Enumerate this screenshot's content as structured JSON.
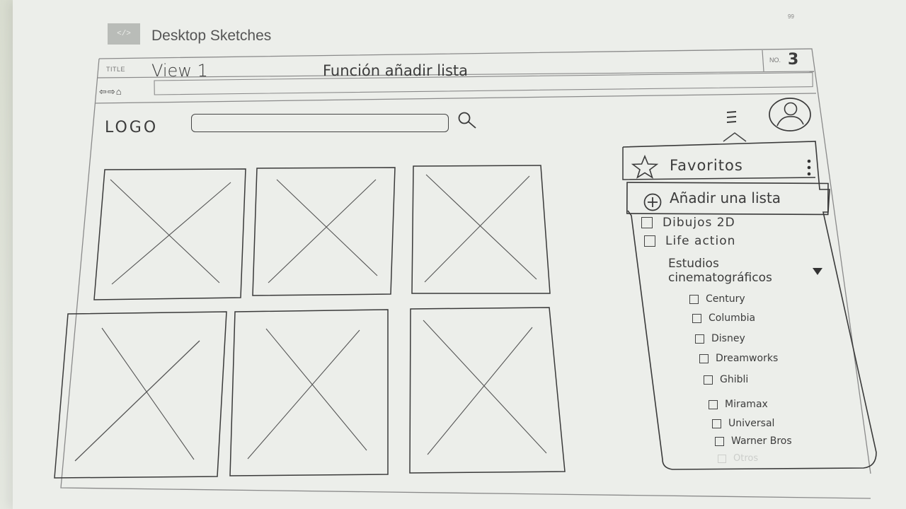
{
  "brand": {
    "logo_text": "</>",
    "title": "Desktop Sketches",
    "page_mark": "99"
  },
  "header": {
    "title_label": "TITLE",
    "view_name": "View 1",
    "view_description": "Función añadir lista",
    "no_label": "NO.",
    "number": "3"
  },
  "browser": {
    "nav_icons": "⇦⇨⌂",
    "url": ""
  },
  "topbar": {
    "logo": "LOGO",
    "search_placeholder": ""
  },
  "dropdown": {
    "favorites_label": "Favoritos",
    "add_list_label": "Añadir una lista",
    "top_items": [
      "Dibujos 2D",
      "Life action"
    ],
    "studios_heading_line1": "Estudios",
    "studios_heading_line2": "cinematográficos",
    "studios": [
      "Century",
      "Columbia",
      "Disney",
      "Dreamworks",
      "Ghibli",
      "Miramax",
      "Universal",
      "Warner Bros",
      "Otros"
    ]
  },
  "icons": [
    "search-icon",
    "hamburger-icon",
    "avatar-icon",
    "star-icon",
    "kebab-icon",
    "add-circle-icon",
    "caret-down-icon",
    "image-placeholder-icon"
  ]
}
